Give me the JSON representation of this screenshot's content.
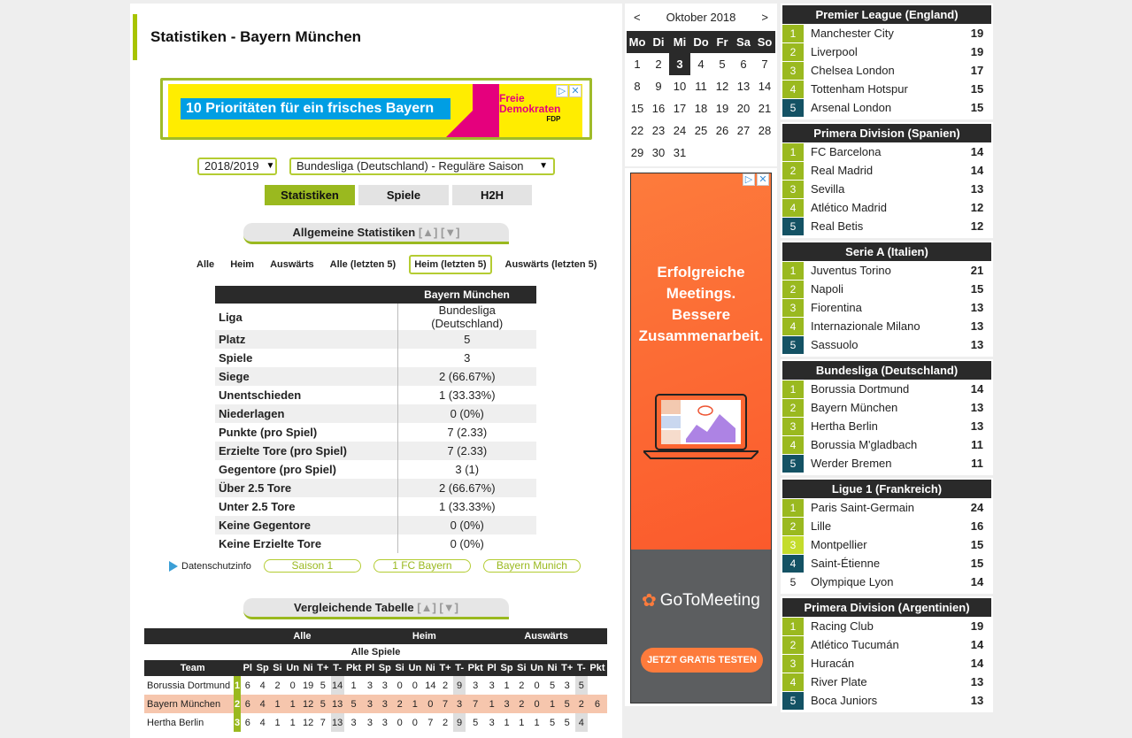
{
  "page_title": "Statistiken - Bayern München",
  "ad_banner": {
    "headline": "10 Prioritäten für ein frisches Bayern",
    "brand_line1": "Freie",
    "brand_line2": "Demokraten",
    "brand_short": "FDP"
  },
  "season_select": {
    "value": "2018/2019"
  },
  "competition_select": {
    "value": "Bundesliga (Deutschland) - Reguläre Saison"
  },
  "tabs": [
    {
      "label": "Statistiken",
      "active": true
    },
    {
      "label": "Spiele",
      "active": false
    },
    {
      "label": "H2H",
      "active": false
    }
  ],
  "general_stats": {
    "heading": "Allgemeine Statistiken",
    "sort_up": "[▲]",
    "sort_down": "[▼]",
    "filters": [
      {
        "label": "Alle",
        "active": false
      },
      {
        "label": "Heim",
        "active": false
      },
      {
        "label": "Auswärts",
        "active": false
      },
      {
        "label": "Alle (letzten 5)",
        "active": false
      },
      {
        "label": "Heim (letzten 5)",
        "active": true
      },
      {
        "label": "Auswärts (letzten 5)",
        "active": false
      }
    ],
    "column_header": "Bayern München",
    "rows": [
      {
        "label": "Liga",
        "value": "Bundesliga (Deutschland)"
      },
      {
        "label": "Platz",
        "value": "5"
      },
      {
        "label": "Spiele",
        "value": "3"
      },
      {
        "label": "Siege",
        "value": "2 (66.67%)"
      },
      {
        "label": "Unentschieden",
        "value": "1 (33.33%)"
      },
      {
        "label": "Niederlagen",
        "value": "0 (0%)"
      },
      {
        "label": "Punkte (pro Spiel)",
        "value": "7 (2.33)"
      },
      {
        "label": "Erzielte Tore (pro Spiel)",
        "value": "7 (2.33)"
      },
      {
        "label": "Gegentore (pro Spiel)",
        "value": "3 (1)"
      },
      {
        "label": "Über 2.5 Tore",
        "value": "2 (66.67%)"
      },
      {
        "label": "Unter 2.5 Tore",
        "value": "1 (33.33%)"
      },
      {
        "label": "Keine Gegentore",
        "value": "0 (0%)"
      },
      {
        "label": "Keine Erzielte Tore",
        "value": "0 (0%)"
      }
    ]
  },
  "privacy": {
    "label": "Datenschutzinfo",
    "tags": [
      "Saison 1",
      "1 FC Bayern",
      "Bayern Munich"
    ]
  },
  "comparison": {
    "heading": "Vergleichende Tabelle",
    "sort_up": "[▲]",
    "sort_down": "[▼]",
    "groups": [
      "Alle",
      "Heim",
      "Auswärts"
    ],
    "subtitle": "Alle Spiele",
    "team_header": "Team",
    "cols": [
      "Pl",
      "Sp",
      "Si",
      "Un",
      "Ni",
      "T+",
      "T-",
      "Pkt",
      "Pl",
      "Sp",
      "Si",
      "Un",
      "Ni",
      "T+",
      "T-",
      "Pkt",
      "Pl",
      "Sp",
      "Si",
      "Un",
      "Ni",
      "T+",
      "T-",
      "Pkt"
    ],
    "rows": [
      {
        "team": "Borussia Dortmund",
        "highlight": false,
        "vals": [
          "1",
          "6",
          "4",
          "2",
          "0",
          "19",
          "5",
          "14",
          "1",
          "3",
          "3",
          "0",
          "0",
          "14",
          "2",
          "9",
          "3",
          "3",
          "1",
          "2",
          "0",
          "5",
          "3",
          "5"
        ]
      },
      {
        "team": "Bayern München",
        "highlight": true,
        "vals": [
          "2",
          "6",
          "4",
          "1",
          "1",
          "12",
          "5",
          "13",
          "5",
          "3",
          "3",
          "2",
          "1",
          "0",
          "7",
          "3",
          "7",
          "1",
          "3",
          "2",
          "0",
          "1",
          "5",
          "2",
          "6"
        ]
      },
      {
        "team": "Hertha Berlin",
        "highlight": false,
        "vals": [
          "3",
          "6",
          "4",
          "1",
          "1",
          "12",
          "7",
          "13",
          "3",
          "3",
          "3",
          "0",
          "0",
          "7",
          "2",
          "9",
          "5",
          "3",
          "1",
          "1",
          "1",
          "5",
          "5",
          "4"
        ]
      }
    ]
  },
  "calendar": {
    "prev": "<",
    "next": ">",
    "month": "Oktober 2018",
    "weekdays": [
      "Mo",
      "Di",
      "Mi",
      "Do",
      "Fr",
      "Sa",
      "So"
    ],
    "days": [
      "1",
      "2",
      "3",
      "4",
      "5",
      "6",
      "7",
      "8",
      "9",
      "10",
      "11",
      "12",
      "13",
      "14",
      "15",
      "16",
      "17",
      "18",
      "19",
      "20",
      "21",
      "22",
      "23",
      "24",
      "25",
      "26",
      "27",
      "28",
      "29",
      "30",
      "31"
    ],
    "today": "3"
  },
  "side_ad": {
    "headline_1": "Erfolgreiche",
    "headline_2": "Meetings.",
    "headline_3": "Bessere",
    "headline_4": "Zusammenarbeit.",
    "logo": "GoToMeeting",
    "cta": "JETZT GRATIS TESTEN"
  },
  "leagues": [
    {
      "name": "Premier League (England)",
      "rows": [
        {
          "rank": "1",
          "team": "Manchester City",
          "pts": "19",
          "color": "g"
        },
        {
          "rank": "2",
          "team": "Liverpool",
          "pts": "19",
          "color": "g"
        },
        {
          "rank": "3",
          "team": "Chelsea London",
          "pts": "17",
          "color": "g"
        },
        {
          "rank": "4",
          "team": "Tottenham Hotspur",
          "pts": "15",
          "color": "g"
        },
        {
          "rank": "5",
          "team": "Arsenal London",
          "pts": "15",
          "color": "b"
        }
      ]
    },
    {
      "name": "Primera Division (Spanien)",
      "rows": [
        {
          "rank": "1",
          "team": "FC Barcelona",
          "pts": "14",
          "color": "g"
        },
        {
          "rank": "2",
          "team": "Real Madrid",
          "pts": "14",
          "color": "g"
        },
        {
          "rank": "3",
          "team": "Sevilla",
          "pts": "13",
          "color": "g"
        },
        {
          "rank": "4",
          "team": "Atlético Madrid",
          "pts": "12",
          "color": "g"
        },
        {
          "rank": "5",
          "team": "Real Betis",
          "pts": "12",
          "color": "b"
        }
      ]
    },
    {
      "name": "Serie A (Italien)",
      "rows": [
        {
          "rank": "1",
          "team": "Juventus Torino",
          "pts": "21",
          "color": "g"
        },
        {
          "rank": "2",
          "team": "Napoli",
          "pts": "15",
          "color": "g"
        },
        {
          "rank": "3",
          "team": "Fiorentina",
          "pts": "13",
          "color": "g"
        },
        {
          "rank": "4",
          "team": "Internazionale Milano",
          "pts": "13",
          "color": "g"
        },
        {
          "rank": "5",
          "team": "Sassuolo",
          "pts": "13",
          "color": "b"
        }
      ]
    },
    {
      "name": "Bundesliga (Deutschland)",
      "rows": [
        {
          "rank": "1",
          "team": "Borussia Dortmund",
          "pts": "14",
          "color": "g"
        },
        {
          "rank": "2",
          "team": "Bayern München",
          "pts": "13",
          "color": "g"
        },
        {
          "rank": "3",
          "team": "Hertha Berlin",
          "pts": "13",
          "color": "g"
        },
        {
          "rank": "4",
          "team": "Borussia M'gladbach",
          "pts": "11",
          "color": "g"
        },
        {
          "rank": "5",
          "team": "Werder Bremen",
          "pts": "11",
          "color": "b"
        }
      ]
    },
    {
      "name": "Ligue 1 (Frankreich)",
      "rows": [
        {
          "rank": "1",
          "team": "Paris Saint-Germain",
          "pts": "24",
          "color": "g"
        },
        {
          "rank": "2",
          "team": "Lille",
          "pts": "16",
          "color": "g"
        },
        {
          "rank": "3",
          "team": "Montpellier",
          "pts": "15",
          "color": "lg"
        },
        {
          "rank": "4",
          "team": "Saint-Étienne",
          "pts": "15",
          "color": "b"
        },
        {
          "rank": "5",
          "team": "Olympique Lyon",
          "pts": "14",
          "color": "w"
        }
      ]
    },
    {
      "name": "Primera Division (Argentinien)",
      "rows": [
        {
          "rank": "1",
          "team": "Racing Club",
          "pts": "19",
          "color": "g"
        },
        {
          "rank": "2",
          "team": "Atlético Tucumán",
          "pts": "14",
          "color": "g"
        },
        {
          "rank": "3",
          "team": "Huracán",
          "pts": "14",
          "color": "g"
        },
        {
          "rank": "4",
          "team": "River Plate",
          "pts": "13",
          "color": "g"
        },
        {
          "rank": "5",
          "team": "Boca Juniors",
          "pts": "13",
          "color": "b"
        }
      ]
    }
  ]
}
